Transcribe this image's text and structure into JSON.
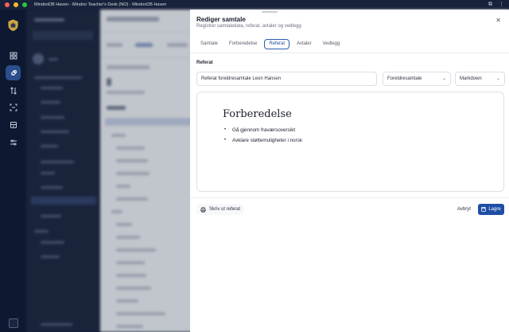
{
  "window": {
    "title": "MindooDB Haven - Mindoo Teacher's Desk (NO) - MindooDB Haven"
  },
  "rail": {
    "items": [
      {
        "icon": "dashboard-icon",
        "active": false
      },
      {
        "icon": "rocket-icon",
        "active": true
      },
      {
        "icon": "transfer-icon",
        "active": false
      },
      {
        "icon": "scan-icon",
        "active": false
      },
      {
        "icon": "database-icon",
        "active": false
      },
      {
        "icon": "sliders-icon",
        "active": false
      }
    ]
  },
  "dialog": {
    "title": "Rediger samtale",
    "subtitle": "Registrer samtaledata, referat, avtaler og vedlegg",
    "tabs": [
      {
        "label": "Samtale",
        "active": false
      },
      {
        "label": "Forberedelse",
        "active": false
      },
      {
        "label": "Referat",
        "active": true
      },
      {
        "label": "Avtaler",
        "active": false
      },
      {
        "label": "Vedlegg",
        "active": false
      }
    ],
    "section_label": "Referat",
    "referat_title_value": "Referat foreldresamtale Leon Hansen",
    "template_select": "Foreldresamtale",
    "format_select": "Markdown",
    "editor": {
      "heading": "Forberedelse",
      "items": [
        "Gå gjennom fraværsoversikt",
        "Avklare støttemuligheter i norsk"
      ]
    },
    "print_label": "Skriv ut referat",
    "cancel_label": "Avbryt",
    "save_label": "Lagre"
  },
  "colors": {
    "accent": "#1e4ea5",
    "rail_active": "#2a4f8c",
    "sidebar": "#0e1830"
  }
}
